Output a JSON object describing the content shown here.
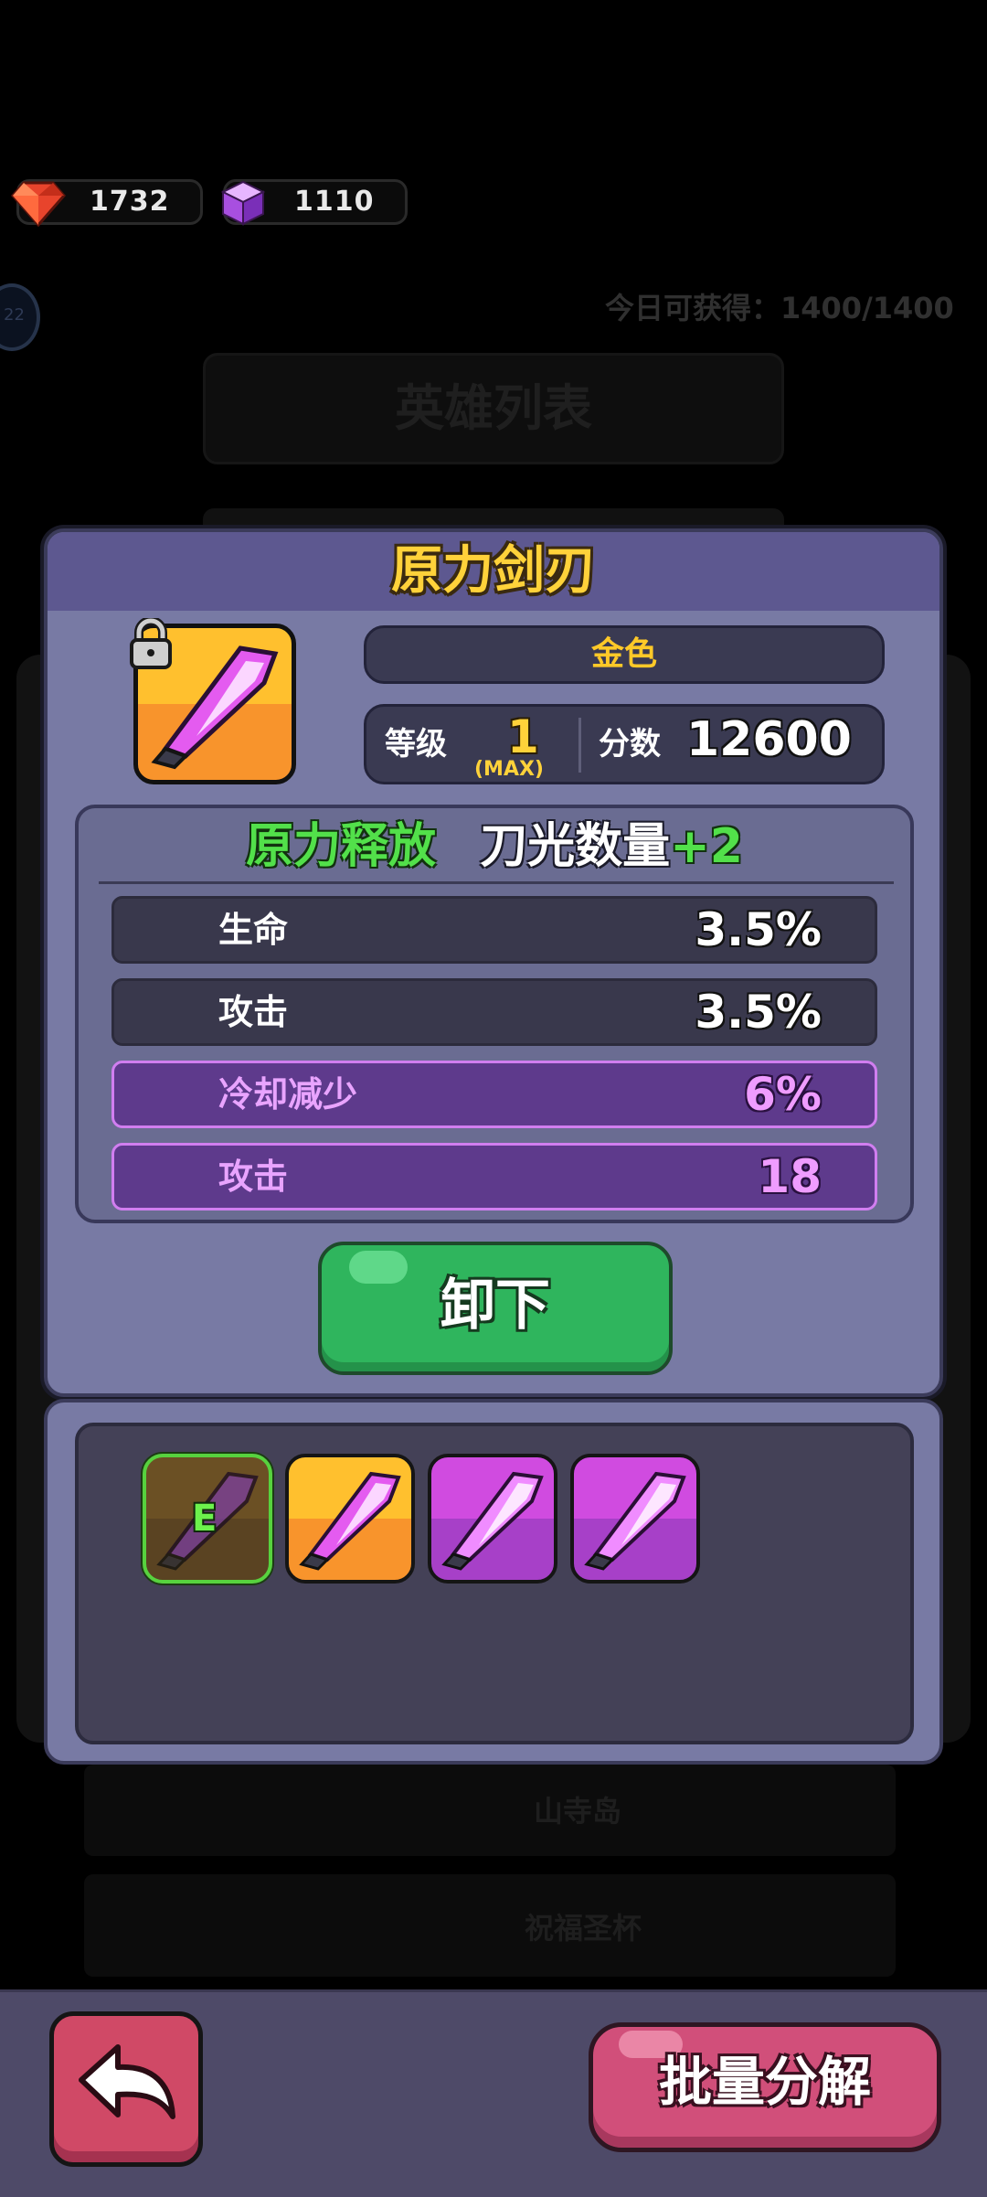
{
  "currencies": [
    {
      "icon": "ruby-gem-icon",
      "value": "1732"
    },
    {
      "icon": "purple-cube-icon",
      "value": "1110"
    }
  ],
  "background": {
    "daily_limit": "今日可获得：1400/1400",
    "list_title": "英雄列表",
    "row_labels": [
      "山寺岛",
      "祝福圣杯"
    ],
    "level_badge": "22"
  },
  "item": {
    "name": "原力剑刃",
    "quality": "金色",
    "level_label": "等级",
    "level_value": "1",
    "level_max": "(MAX)",
    "score_label": "分数",
    "score_value": "12600",
    "locked": true
  },
  "effect": {
    "name": "原力释放",
    "desc": "刀光数量",
    "bonus": "+2"
  },
  "attributes": [
    {
      "name": "生命",
      "value": "3.5%",
      "style": "dark"
    },
    {
      "name": "攻击",
      "value": "3.5%",
      "style": "dark"
    },
    {
      "name": "冷却减少",
      "value": "6%",
      "style": "purple"
    },
    {
      "name": "攻击",
      "value": "18",
      "style": "purple"
    }
  ],
  "unequip_label": "卸下",
  "inventory": [
    {
      "rarity": "equipped",
      "mark": "E"
    },
    {
      "rarity": "gold"
    },
    {
      "rarity": "purple"
    },
    {
      "rarity": "purple"
    }
  ],
  "bottom": {
    "batch_decompose_label": "批量分解"
  },
  "colors": {
    "gold_text": "#ffd23a",
    "green_effect": "#52e04a",
    "purple_attr": "#ef9cff",
    "unequip_green": "#2fb55d",
    "batch_pink": "#d14f7a"
  }
}
